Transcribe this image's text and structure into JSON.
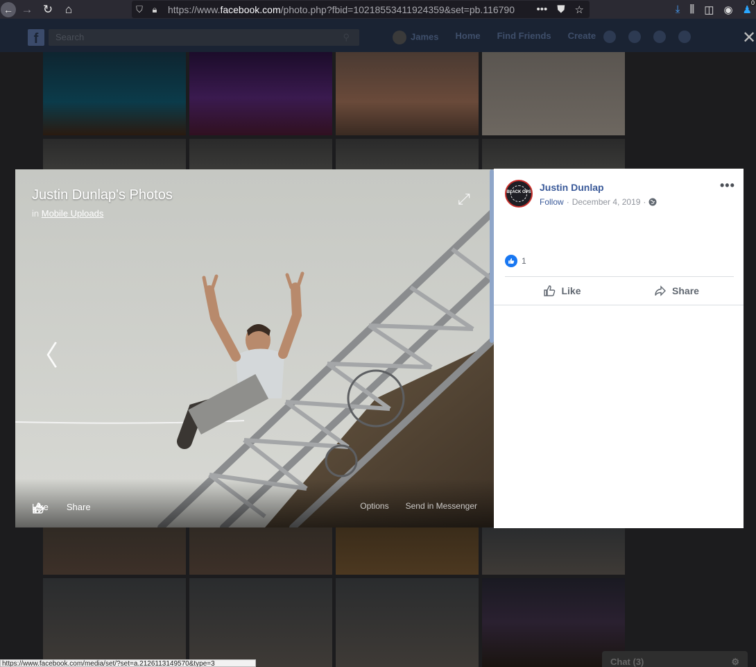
{
  "browser": {
    "url_prefix": "https://www.",
    "url_domain": "facebook.com",
    "url_suffix": "/photo.php?fbid=10218553411924359&set=pb.116790",
    "more_label": "•••",
    "extension_badge": "0"
  },
  "fb_header": {
    "search_placeholder": "Search",
    "nav": [
      "James",
      "Home",
      "Find Friends",
      "Create"
    ]
  },
  "viewer": {
    "album_title": "Justin Dunlap's Photos",
    "in_label": "in",
    "album_link": "Mobile Uploads",
    "actions": {
      "like": "Like",
      "share": "Share"
    },
    "options_label": "Options",
    "send_label": "Send in Messenger"
  },
  "post": {
    "poster_name": "Justin Dunlap",
    "avatar_text": "BLACK OPS",
    "follow_label": "Follow",
    "separator": "·",
    "date": "December 4, 2019",
    "reaction_count": "1",
    "actions": {
      "like": "Like",
      "share": "Share"
    }
  },
  "status_bar": {
    "link": "https://www.facebook.com/media/set/?set=a.2126113149570&type=3"
  },
  "chat": {
    "label": "Chat (3)"
  },
  "colors": {
    "fb_blue": "#385898",
    "like_blue": "#1877f2",
    "panel_bg": "#ffffff"
  }
}
